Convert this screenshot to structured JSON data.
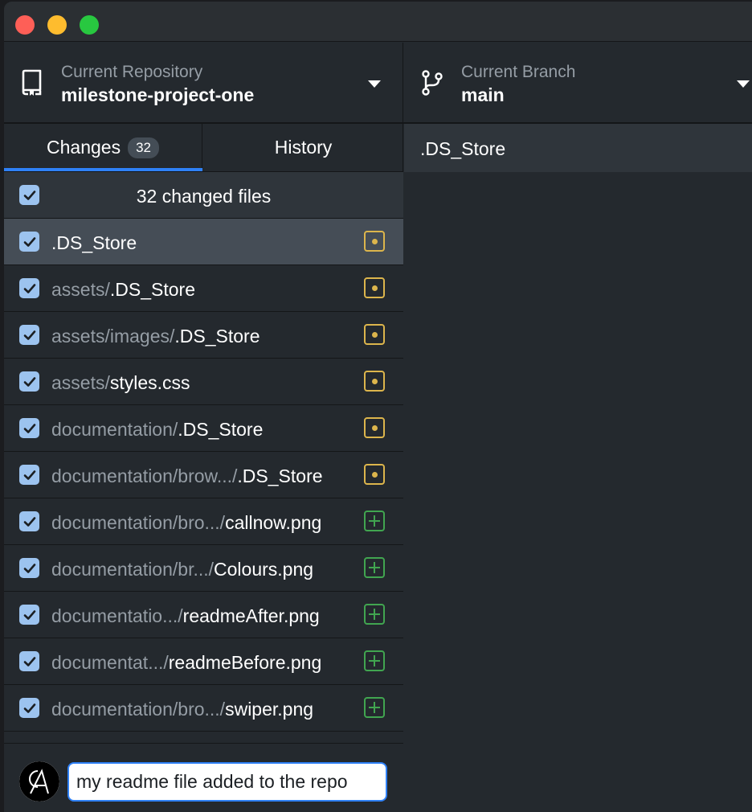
{
  "toolbar": {
    "repository": {
      "label": "Current Repository",
      "value": "milestone-project-one",
      "icon": "repo-icon"
    },
    "branch": {
      "label": "Current Branch",
      "value": "main",
      "icon": "git-branch-icon"
    }
  },
  "sidebar": {
    "tabs": [
      {
        "label": "Changes",
        "badge": "32",
        "active": true
      },
      {
        "label": "History",
        "active": false
      }
    ],
    "header": {
      "text": "32 changed files",
      "checked": true
    },
    "files": [
      {
        "dir": "",
        "name": ".DS_Store",
        "status": "modified",
        "checked": true,
        "selected": true
      },
      {
        "dir": "assets/",
        "name": ".DS_Store",
        "status": "modified",
        "checked": true
      },
      {
        "dir": "assets/images/",
        "name": ".DS_Store",
        "status": "modified",
        "checked": true
      },
      {
        "dir": "assets/",
        "name": "styles.css",
        "status": "modified",
        "checked": true
      },
      {
        "dir": "documentation/",
        "name": ".DS_Store",
        "status": "modified",
        "checked": true
      },
      {
        "dir": "documentation/brow.../",
        "name": ".DS_Store",
        "status": "modified",
        "checked": true
      },
      {
        "dir": "documentation/bro.../",
        "name": "callnow.png",
        "status": "added",
        "checked": true
      },
      {
        "dir": "documentation/br.../",
        "name": "Colours.png",
        "status": "added",
        "checked": true
      },
      {
        "dir": "documentatio.../",
        "name": "readmeAfter.png",
        "status": "added",
        "checked": true
      },
      {
        "dir": "documentat.../",
        "name": "readmeBefore.png",
        "status": "added",
        "checked": true
      },
      {
        "dir": "documentation/bro.../",
        "name": "swiper.png",
        "status": "added",
        "checked": true
      }
    ],
    "commit": {
      "summary_value": "my readme file added to the repo"
    }
  },
  "main": {
    "title": ".DS_Store"
  },
  "colors": {
    "accent": "#2f81f7",
    "modified": "#dcb54c",
    "added": "#41a550",
    "checkbox": "#9cc3ef"
  }
}
